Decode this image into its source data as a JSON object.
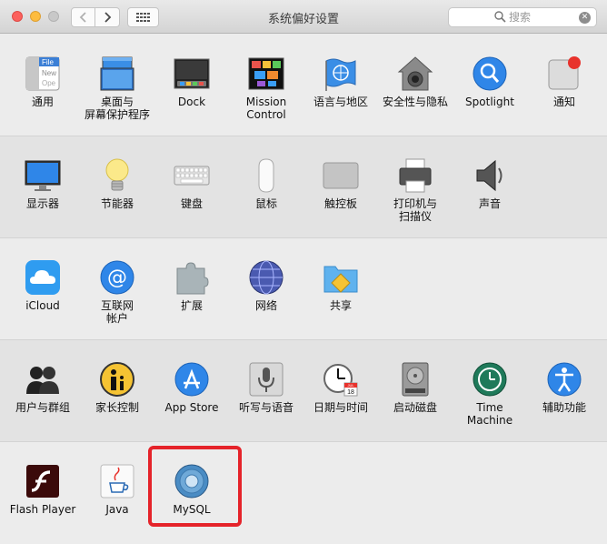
{
  "window": {
    "title": "系统偏好设置"
  },
  "search": {
    "placeholder": "搜索"
  },
  "rows": [
    [
      {
        "label": "通用",
        "icon": "general-icon"
      },
      {
        "label": "桌面与\n屏幕保护程序",
        "icon": "desktop-screensaver-icon"
      },
      {
        "label": "Dock",
        "icon": "dock-icon"
      },
      {
        "label": "Mission\nControl",
        "icon": "mission-control-icon"
      },
      {
        "label": "语言与地区",
        "icon": "language-region-icon"
      },
      {
        "label": "安全性与隐私",
        "icon": "security-privacy-icon"
      },
      {
        "label": "Spotlight",
        "icon": "spotlight-icon"
      },
      {
        "label": "通知",
        "icon": "notifications-icon"
      }
    ],
    [
      {
        "label": "显示器",
        "icon": "displays-icon"
      },
      {
        "label": "节能器",
        "icon": "energy-saver-icon"
      },
      {
        "label": "键盘",
        "icon": "keyboard-icon"
      },
      {
        "label": "鼠标",
        "icon": "mouse-icon"
      },
      {
        "label": "触控板",
        "icon": "trackpad-icon"
      },
      {
        "label": "打印机与\n扫描仪",
        "icon": "printers-scanners-icon"
      },
      {
        "label": "声音",
        "icon": "sound-icon"
      }
    ],
    [
      {
        "label": "iCloud",
        "icon": "icloud-icon"
      },
      {
        "label": "互联网\n帐户",
        "icon": "internet-accounts-icon"
      },
      {
        "label": "扩展",
        "icon": "extensions-icon"
      },
      {
        "label": "网络",
        "icon": "network-icon"
      },
      {
        "label": "共享",
        "icon": "sharing-icon"
      }
    ],
    [
      {
        "label": "用户与群组",
        "icon": "users-groups-icon"
      },
      {
        "label": "家长控制",
        "icon": "parental-controls-icon"
      },
      {
        "label": "App Store",
        "icon": "app-store-icon"
      },
      {
        "label": "听写与语音",
        "icon": "dictation-speech-icon"
      },
      {
        "label": "日期与时间",
        "icon": "date-time-icon"
      },
      {
        "label": "启动磁盘",
        "icon": "startup-disk-icon"
      },
      {
        "label": "Time Machine",
        "icon": "time-machine-icon"
      },
      {
        "label": "辅助功能",
        "icon": "accessibility-icon"
      }
    ],
    [
      {
        "label": "Flash Player",
        "icon": "flash-player-icon"
      },
      {
        "label": "Java",
        "icon": "java-icon"
      },
      {
        "label": "MySQL",
        "icon": "mysql-icon"
      }
    ]
  ],
  "general_icon_text": [
    "File",
    "New",
    "Ope"
  ],
  "calendar_day": "18",
  "calendar_month": "JUL",
  "colors": {
    "highlight": "#e5232a",
    "accent": "#1a82fb"
  }
}
